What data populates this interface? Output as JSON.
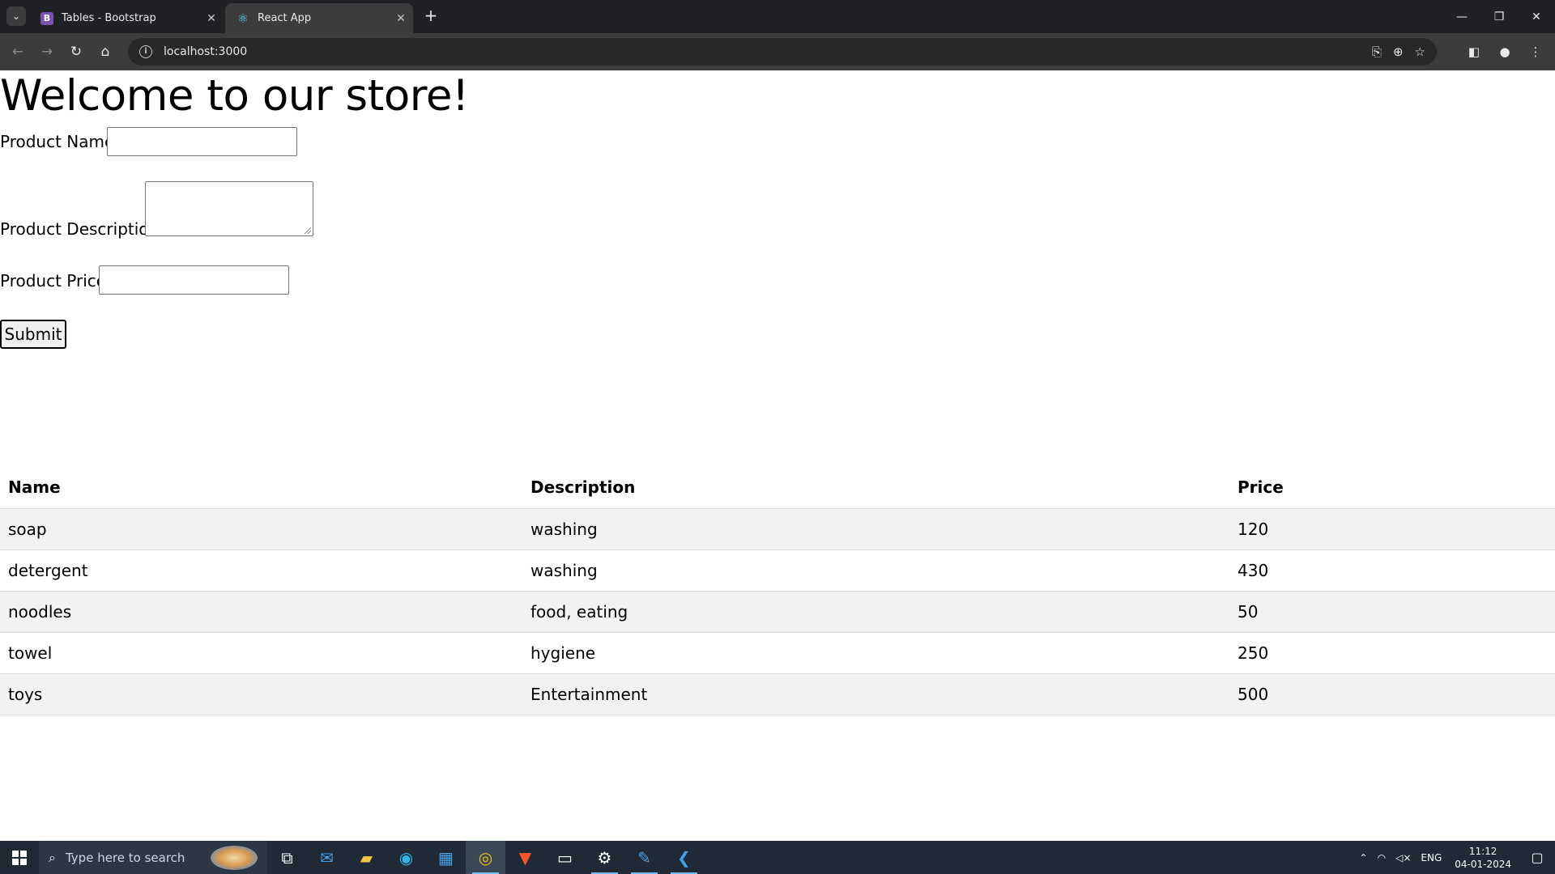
{
  "browser": {
    "tabs": [
      {
        "title": "Tables - Bootstrap",
        "favicon": "B",
        "active": false
      },
      {
        "title": "React App",
        "favicon": "⚛",
        "active": true
      }
    ],
    "url": "localhost:3000"
  },
  "page": {
    "heading": "Welcome to our store!",
    "form": {
      "name_label": "Product Name:",
      "name_value": "",
      "description_label": "Product Description:",
      "description_value": "",
      "price_label": "Product Price:",
      "price_value": "",
      "submit_label": "Submit"
    },
    "table": {
      "headers": [
        "Name",
        "Description",
        "Price"
      ],
      "rows": [
        [
          "soap",
          "washing",
          "120"
        ],
        [
          "detergent",
          "washing",
          "430"
        ],
        [
          "noodles",
          "food, eating",
          "50"
        ],
        [
          "towel",
          "hygiene",
          "250"
        ],
        [
          "toys",
          "Entertainment",
          "500"
        ]
      ]
    }
  },
  "taskbar": {
    "search_placeholder": "Type here to search",
    "language": "ENG",
    "time": "11:12",
    "date": "04-01-2024"
  }
}
